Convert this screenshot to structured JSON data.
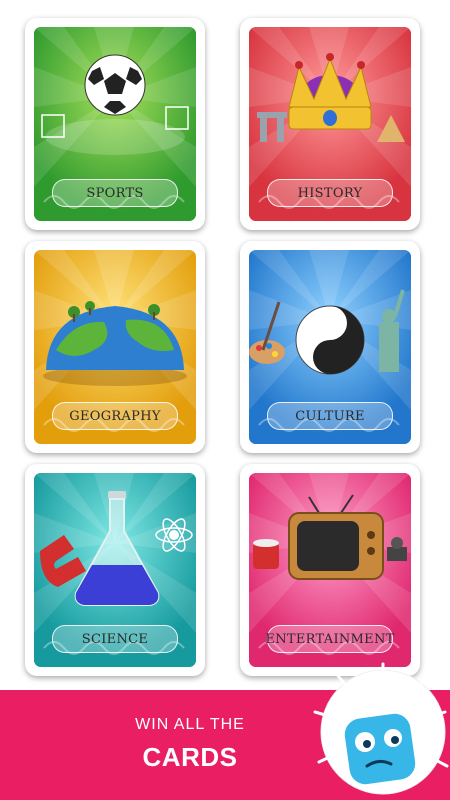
{
  "categories": [
    {
      "label": "SPORTS",
      "color": "#3fa535"
    },
    {
      "label": "HISTORY",
      "color": "#e0434b"
    },
    {
      "label": "GEOGRAPHY",
      "color": "#e8a912"
    },
    {
      "label": "CULTURE",
      "color": "#2f86d6"
    },
    {
      "label": "SCIENCE",
      "color": "#1aa6a9"
    },
    {
      "label": "ENTERTAINMENT",
      "color": "#e5357e"
    }
  ],
  "banner": {
    "line1": "WIN ALL THE",
    "line2": "CARDS",
    "color": "#e91e63"
  },
  "mascot": {
    "icon": "blue-cube-mascot-icon"
  }
}
